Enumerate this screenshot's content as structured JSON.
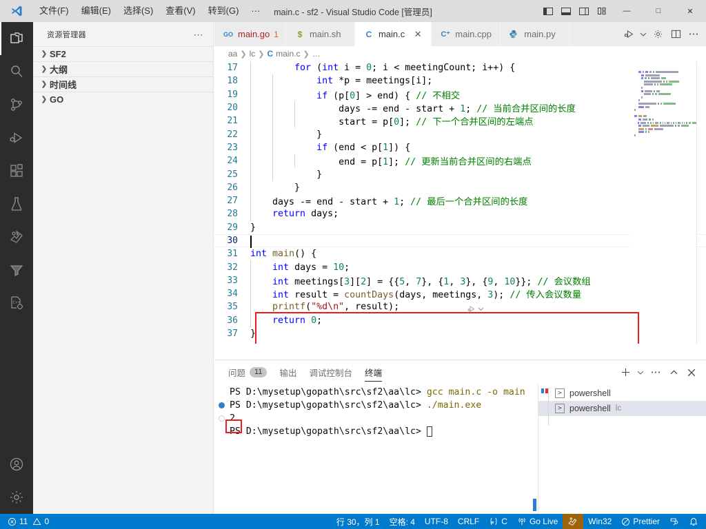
{
  "titlebar": {
    "logo_icon": "vscode-logo-icon",
    "menus": [
      {
        "label": "文件(F)"
      },
      {
        "label": "编辑(E)"
      },
      {
        "label": "选择(S)"
      },
      {
        "label": "查看(V)"
      },
      {
        "label": "转到(G)"
      },
      {
        "label": "···"
      }
    ],
    "title": "main.c - sf2 - Visual Studio Code [管理员]",
    "layout_buttons": [
      {
        "name": "toggle-primary-sidebar-icon"
      },
      {
        "name": "toggle-panel-icon"
      },
      {
        "name": "toggle-secondary-sidebar-icon"
      },
      {
        "name": "customize-layout-icon"
      }
    ],
    "window_buttons": [
      {
        "name": "minimize-button",
        "glyph": "—"
      },
      {
        "name": "maximize-button",
        "glyph": "□"
      },
      {
        "name": "close-button",
        "glyph": "✕"
      }
    ]
  },
  "activitybar": {
    "items": [
      {
        "name": "explorer",
        "icon": "files-icon",
        "active": true
      },
      {
        "name": "search",
        "icon": "search-icon",
        "active": false
      },
      {
        "name": "source-control",
        "icon": "source-control-icon",
        "active": false
      },
      {
        "name": "run-and-debug",
        "icon": "run-debug-icon",
        "active": false
      },
      {
        "name": "extensions",
        "icon": "extensions-icon",
        "active": false
      },
      {
        "name": "testing",
        "icon": "beaker-icon",
        "active": false
      },
      {
        "name": "go-extension",
        "icon": "go-gopher-icon",
        "active": false
      },
      {
        "name": "filter-funnel",
        "icon": "funnel-icon",
        "active": false
      },
      {
        "name": "cpp-tools",
        "icon": "cpp-gear-icon",
        "active": false
      }
    ],
    "bottom_items": [
      {
        "name": "accounts",
        "icon": "account-icon"
      },
      {
        "name": "manage-settings",
        "icon": "gear-icon"
      }
    ]
  },
  "sidebar": {
    "title": "资源管理器",
    "more_actions_icon": "ellipsis-icon",
    "trees": [
      {
        "label": "SF2",
        "expanded": false
      },
      {
        "label": "大纲",
        "expanded": false
      },
      {
        "label": "时间线",
        "expanded": false
      },
      {
        "label": "GO",
        "expanded": false
      }
    ]
  },
  "tabs": [
    {
      "label": "main.go",
      "icon": "go-file-icon",
      "icon_text": "GO",
      "badge": "1",
      "active": false,
      "red": true
    },
    {
      "label": "main.sh",
      "icon": "shell-file-icon",
      "icon_text": "$",
      "active": false
    },
    {
      "label": "main.c",
      "icon": "c-file-icon",
      "icon_text": "C",
      "active": true,
      "close": "✕"
    },
    {
      "label": "main.cpp",
      "icon": "cpp-file-icon",
      "icon_text": "C⁺",
      "active": false
    },
    {
      "label": "main.py",
      "icon": "python-file-icon",
      "icon_text": "·",
      "active": false
    }
  ],
  "tab_actions": [
    {
      "name": "run-or-debug-button",
      "icon": "run-play-icon"
    },
    {
      "name": "run-chevron-button",
      "icon": "chevron-down-icon"
    },
    {
      "name": "c-cpp-config-button",
      "icon": "gear-icon"
    },
    {
      "name": "split-editor-button",
      "icon": "split-editor-icon"
    },
    {
      "name": "more-actions-button",
      "icon": "ellipsis-icon"
    }
  ],
  "breadcrumbs": [
    {
      "label": "aa"
    },
    {
      "label": "lc"
    },
    {
      "label": "main.c",
      "icon": "c-file-icon"
    },
    {
      "label": "…"
    }
  ],
  "editor": {
    "codelens": {
      "run_icon": "run-codelens-icon",
      "chevron_icon": "chevron-down-icon"
    },
    "highlight_color": "#f01c1c",
    "lines": [
      {
        "n": "17",
        "indent": 1,
        "tokens": [
          {
            "t": "        ",
            "c": "plain"
          },
          {
            "t": "for",
            "c": "kw"
          },
          {
            "t": " (",
            "c": "plain"
          },
          {
            "t": "int",
            "c": "kw"
          },
          {
            "t": " i = ",
            "c": "plain"
          },
          {
            "t": "0",
            "c": "num"
          },
          {
            "t": "; i < meetingCount; i++) {",
            "c": "plain"
          }
        ]
      },
      {
        "n": "18",
        "indent": 2,
        "tokens": [
          {
            "t": "            ",
            "c": "plain"
          },
          {
            "t": "int",
            "c": "kw"
          },
          {
            "t": " *p = meetings[i];",
            "c": "plain"
          }
        ]
      },
      {
        "n": "19",
        "indent": 2,
        "tokens": [
          {
            "t": "            ",
            "c": "plain"
          },
          {
            "t": "if",
            "c": "kw"
          },
          {
            "t": " (p[",
            "c": "plain"
          },
          {
            "t": "0",
            "c": "num"
          },
          {
            "t": "] > end) { ",
            "c": "plain"
          },
          {
            "t": "// 不相交",
            "c": "cmt"
          }
        ]
      },
      {
        "n": "20",
        "indent": 3,
        "tokens": [
          {
            "t": "                ",
            "c": "plain"
          },
          {
            "t": "days -= end - start + ",
            "c": "plain"
          },
          {
            "t": "1",
            "c": "num"
          },
          {
            "t": "; ",
            "c": "plain"
          },
          {
            "t": "// 当前合并区间的长度",
            "c": "cmt"
          }
        ]
      },
      {
        "n": "21",
        "indent": 3,
        "tokens": [
          {
            "t": "                ",
            "c": "plain"
          },
          {
            "t": "start = p[",
            "c": "plain"
          },
          {
            "t": "0",
            "c": "num"
          },
          {
            "t": "]; ",
            "c": "plain"
          },
          {
            "t": "// 下一个合并区间的左端点",
            "c": "cmt"
          }
        ]
      },
      {
        "n": "22",
        "indent": 2,
        "tokens": [
          {
            "t": "            }",
            "c": "plain"
          }
        ]
      },
      {
        "n": "23",
        "indent": 2,
        "tokens": [
          {
            "t": "            ",
            "c": "plain"
          },
          {
            "t": "if",
            "c": "kw"
          },
          {
            "t": " (end < p[",
            "c": "plain"
          },
          {
            "t": "1",
            "c": "num"
          },
          {
            "t": "]) {",
            "c": "plain"
          }
        ]
      },
      {
        "n": "24",
        "indent": 3,
        "tokens": [
          {
            "t": "                ",
            "c": "plain"
          },
          {
            "t": "end = p[",
            "c": "plain"
          },
          {
            "t": "1",
            "c": "num"
          },
          {
            "t": "]; ",
            "c": "plain"
          },
          {
            "t": "// 更新当前合并区间的右端点",
            "c": "cmt"
          }
        ]
      },
      {
        "n": "25",
        "indent": 2,
        "tokens": [
          {
            "t": "            }",
            "c": "plain"
          }
        ]
      },
      {
        "n": "26",
        "indent": 1,
        "tokens": [
          {
            "t": "        }",
            "c": "plain"
          }
        ]
      },
      {
        "n": "27",
        "indent": 1,
        "tokens": [
          {
            "t": "    days -= end - start + ",
            "c": "plain"
          },
          {
            "t": "1",
            "c": "num"
          },
          {
            "t": "; ",
            "c": "plain"
          },
          {
            "t": "// 最后一个合并区间的长度",
            "c": "cmt"
          }
        ]
      },
      {
        "n": "28",
        "indent": 1,
        "tokens": [
          {
            "t": "    ",
            "c": "plain"
          },
          {
            "t": "return",
            "c": "kw"
          },
          {
            "t": " days;",
            "c": "plain"
          }
        ]
      },
      {
        "n": "29",
        "indent": 0,
        "tokens": [
          {
            "t": "}",
            "c": "plain"
          }
        ]
      },
      {
        "n": "30",
        "indent": 0,
        "current": true,
        "tokens": [
          {
            "t": "",
            "c": "plain"
          }
        ]
      },
      {
        "n": "31",
        "indent": 0,
        "tokens": [
          {
            "t": "int",
            "c": "kw"
          },
          {
            "t": " ",
            "c": "plain"
          },
          {
            "t": "main",
            "c": "fn"
          },
          {
            "t": "() {",
            "c": "plain"
          }
        ]
      },
      {
        "n": "32",
        "indent": 1,
        "tokens": [
          {
            "t": "    ",
            "c": "plain"
          },
          {
            "t": "int",
            "c": "kw"
          },
          {
            "t": " days = ",
            "c": "plain"
          },
          {
            "t": "10",
            "c": "num"
          },
          {
            "t": ";",
            "c": "plain"
          }
        ]
      },
      {
        "n": "33",
        "indent": 1,
        "tokens": [
          {
            "t": "    ",
            "c": "plain"
          },
          {
            "t": "int",
            "c": "kw"
          },
          {
            "t": " meetings[",
            "c": "plain"
          },
          {
            "t": "3",
            "c": "num"
          },
          {
            "t": "][",
            "c": "plain"
          },
          {
            "t": "2",
            "c": "num"
          },
          {
            "t": "] = {{",
            "c": "plain"
          },
          {
            "t": "5",
            "c": "num"
          },
          {
            "t": ", ",
            "c": "plain"
          },
          {
            "t": "7",
            "c": "num"
          },
          {
            "t": "}, {",
            "c": "plain"
          },
          {
            "t": "1",
            "c": "num"
          },
          {
            "t": ", ",
            "c": "plain"
          },
          {
            "t": "3",
            "c": "num"
          },
          {
            "t": "}, {",
            "c": "plain"
          },
          {
            "t": "9",
            "c": "num"
          },
          {
            "t": ", ",
            "c": "plain"
          },
          {
            "t": "10",
            "c": "num"
          },
          {
            "t": "}}; ",
            "c": "plain"
          },
          {
            "t": "// 会议数组",
            "c": "cmt"
          }
        ]
      },
      {
        "n": "34",
        "indent": 1,
        "tokens": [
          {
            "t": "    ",
            "c": "plain"
          },
          {
            "t": "int",
            "c": "kw"
          },
          {
            "t": " result = ",
            "c": "plain"
          },
          {
            "t": "countDays",
            "c": "fn"
          },
          {
            "t": "(days, meetings, ",
            "c": "plain"
          },
          {
            "t": "3",
            "c": "num"
          },
          {
            "t": "); ",
            "c": "plain"
          },
          {
            "t": "// 传入会议数量",
            "c": "cmt"
          }
        ]
      },
      {
        "n": "35",
        "indent": 1,
        "tokens": [
          {
            "t": "    ",
            "c": "plain"
          },
          {
            "t": "printf",
            "c": "fn"
          },
          {
            "t": "(",
            "c": "plain"
          },
          {
            "t": "\"%d\\n\"",
            "c": "str"
          },
          {
            "t": ", result);",
            "c": "plain"
          }
        ]
      },
      {
        "n": "36",
        "indent": 1,
        "tokens": [
          {
            "t": "    ",
            "c": "plain"
          },
          {
            "t": "return",
            "c": "kw"
          },
          {
            "t": " ",
            "c": "plain"
          },
          {
            "t": "0",
            "c": "num"
          },
          {
            "t": ";",
            "c": "plain"
          }
        ]
      },
      {
        "n": "37",
        "indent": 0,
        "tokens": [
          {
            "t": "}",
            "c": "plain"
          }
        ]
      }
    ]
  },
  "panel": {
    "tabs": [
      {
        "label": "问题",
        "count": "11",
        "active": false
      },
      {
        "label": "输出",
        "active": false
      },
      {
        "label": "调试控制台",
        "active": false
      },
      {
        "label": "终端",
        "active": true
      }
    ],
    "actions": [
      {
        "name": "new-terminal-button",
        "icon": "plus-icon"
      },
      {
        "name": "terminal-profile-chevron",
        "icon": "chevron-down-icon"
      },
      {
        "name": "panel-more-actions",
        "icon": "ellipsis-icon"
      },
      {
        "name": "maximize-panel-button",
        "icon": "chevron-up-icon"
      },
      {
        "name": "close-panel-button",
        "icon": "close-icon"
      }
    ],
    "terminal_lines": [
      {
        "prompt": "PS D:\\mysetup\\gopath\\src\\sf2\\aa\\lc> ",
        "command": "gcc main.c -o main",
        "marker": "none"
      },
      {
        "prompt": "PS D:\\mysetup\\gopath\\src\\sf2\\aa\\lc> ",
        "command": "./main.exe",
        "marker": "dot"
      },
      {
        "prompt": "",
        "output": "2",
        "marker": "hollow",
        "highlighted": true
      },
      {
        "prompt": "PS D:\\mysetup\\gopath\\src\\sf2\\aa\\lc> ",
        "command": "",
        "cursor": true,
        "marker": "none"
      }
    ],
    "terminal_list": [
      {
        "label": "powershell",
        "sub": "",
        "icon": "terminal-icon",
        "selected": false
      },
      {
        "label": "powershell",
        "sub": "lc",
        "icon": "terminal-icon",
        "selected": true
      }
    ]
  },
  "statusbar": {
    "left": [
      {
        "name": "problems",
        "icon": "error-icon",
        "text": "11",
        "icon2": "warning-icon",
        "text2": "0"
      }
    ],
    "right": [
      {
        "name": "cursor-position",
        "text": "行 30，列 1"
      },
      {
        "name": "indentation",
        "text": "空格: 4"
      },
      {
        "name": "encoding",
        "text": "UTF-8"
      },
      {
        "name": "eol",
        "text": "CRLF"
      },
      {
        "name": "language-mode",
        "text": "C",
        "icon": "lang-c-icon"
      },
      {
        "name": "go-live",
        "text": "Go Live",
        "icon": "broadcast-icon"
      },
      {
        "name": "gopher-status",
        "text": "",
        "icon": "gopher-icon",
        "gold": true
      },
      {
        "name": "platform",
        "text": "Win32"
      },
      {
        "name": "prettier",
        "text": "Prettier",
        "icon": "prettier-icon"
      },
      {
        "name": "remote-tunnel",
        "text": "",
        "icon": "remote-icon"
      },
      {
        "name": "notifications",
        "text": "",
        "icon": "bell-icon"
      }
    ]
  }
}
